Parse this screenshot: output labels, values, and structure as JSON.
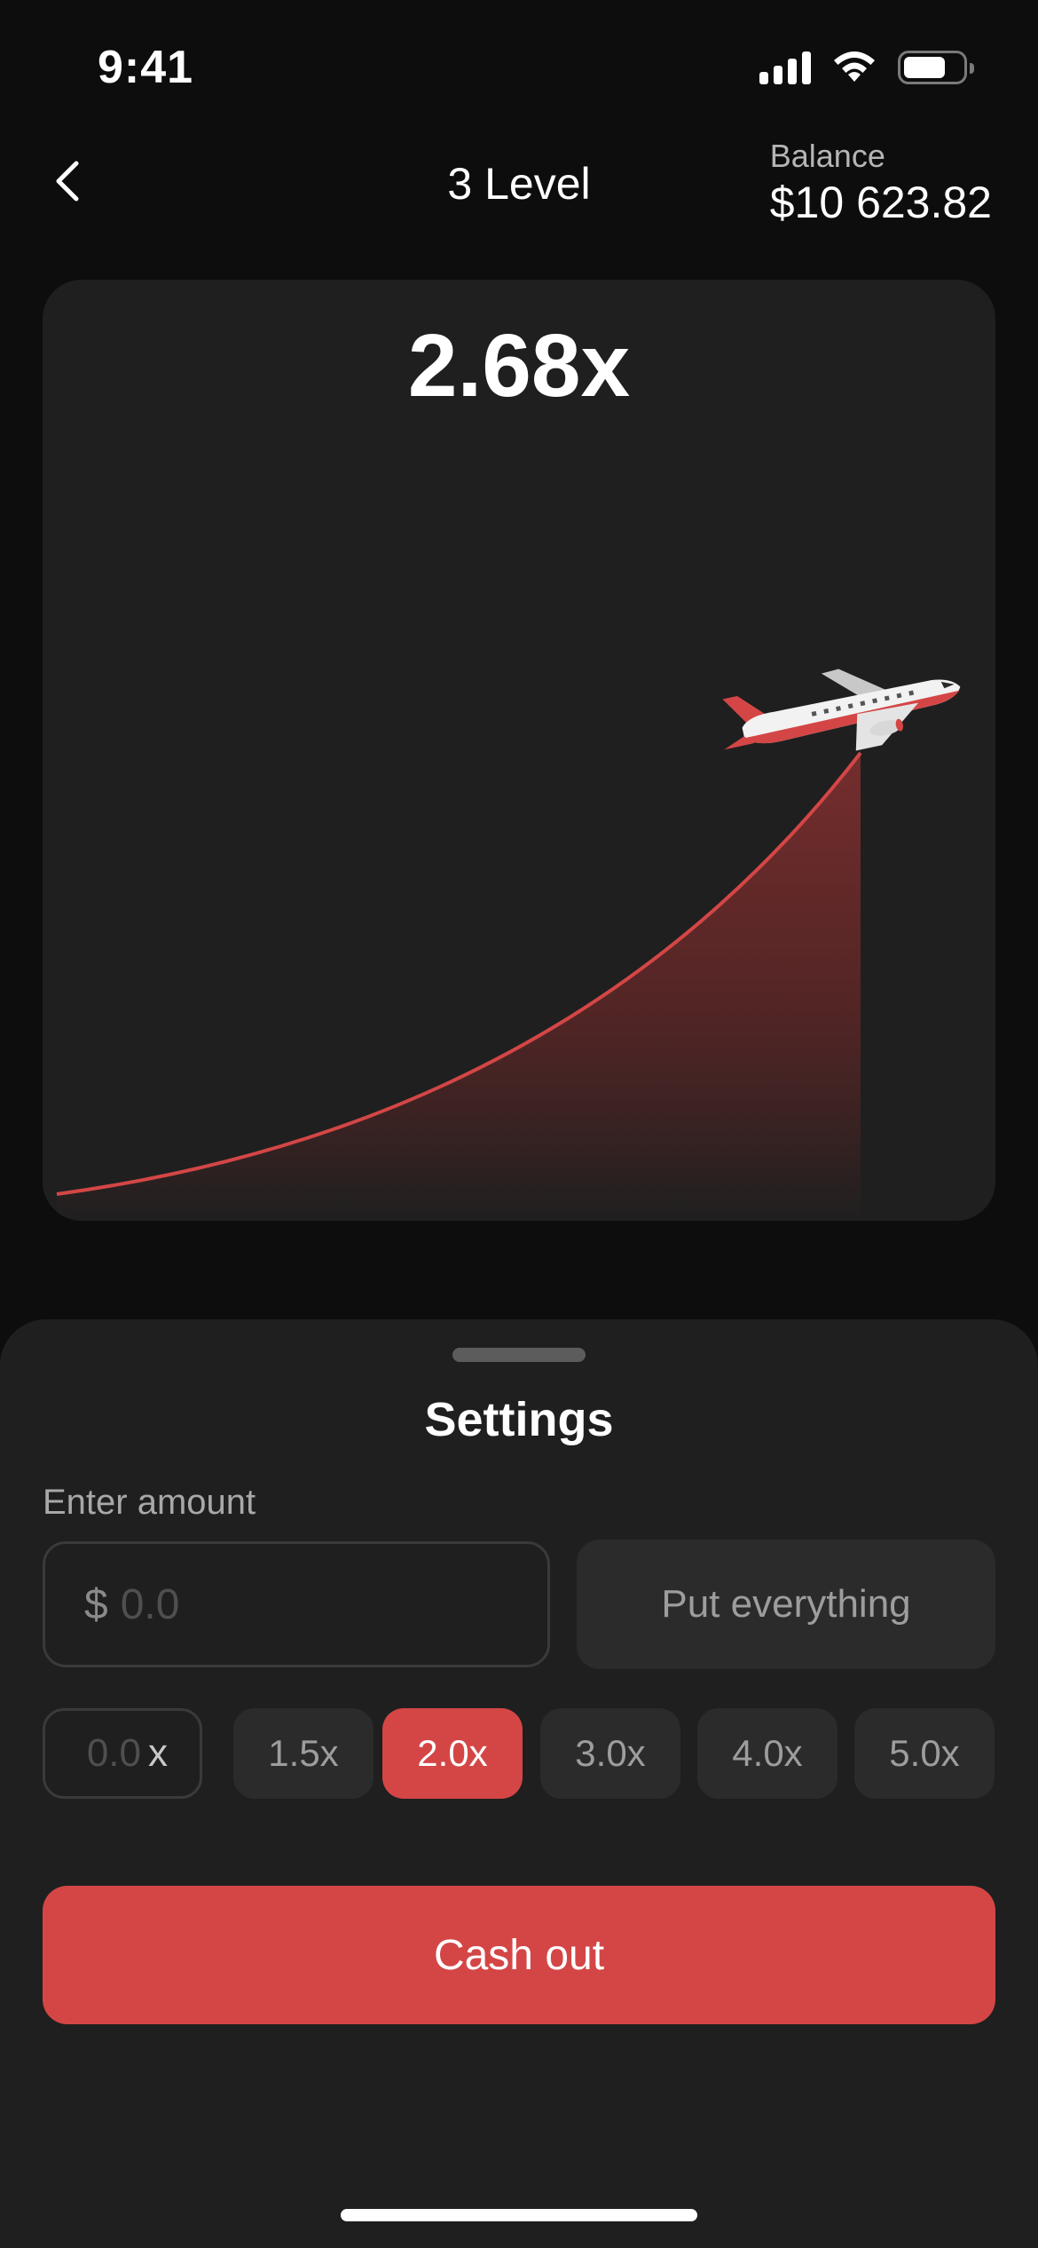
{
  "status_bar": {
    "time": "9:41"
  },
  "header": {
    "back_icon": "chevron-left-icon",
    "title": "3 Level",
    "balance_label": "Balance",
    "balance_value": "$10 623.82"
  },
  "game": {
    "multiplier": "2.68x",
    "plane_icon": "airplane-icon",
    "colors": {
      "curve": "#d44646",
      "card": "#1f1f1f"
    }
  },
  "settings": {
    "title": "Settings",
    "amount_label": "Enter amount",
    "currency_symbol": "$",
    "amount_placeholder": "0.0",
    "put_everything_label": "Put everything",
    "custom_multiplier_placeholder": "0.0",
    "custom_multiplier_suffix": "x",
    "multipliers": [
      {
        "label": "1.5x",
        "selected": false
      },
      {
        "label": "2.0x",
        "selected": true
      },
      {
        "label": "3.0x",
        "selected": false
      },
      {
        "label": "4.0x",
        "selected": false
      },
      {
        "label": "5.0x",
        "selected": false
      }
    ],
    "cash_out_label": "Cash out",
    "colors": {
      "accent": "#d44646",
      "chip": "#2b2b2b"
    }
  }
}
